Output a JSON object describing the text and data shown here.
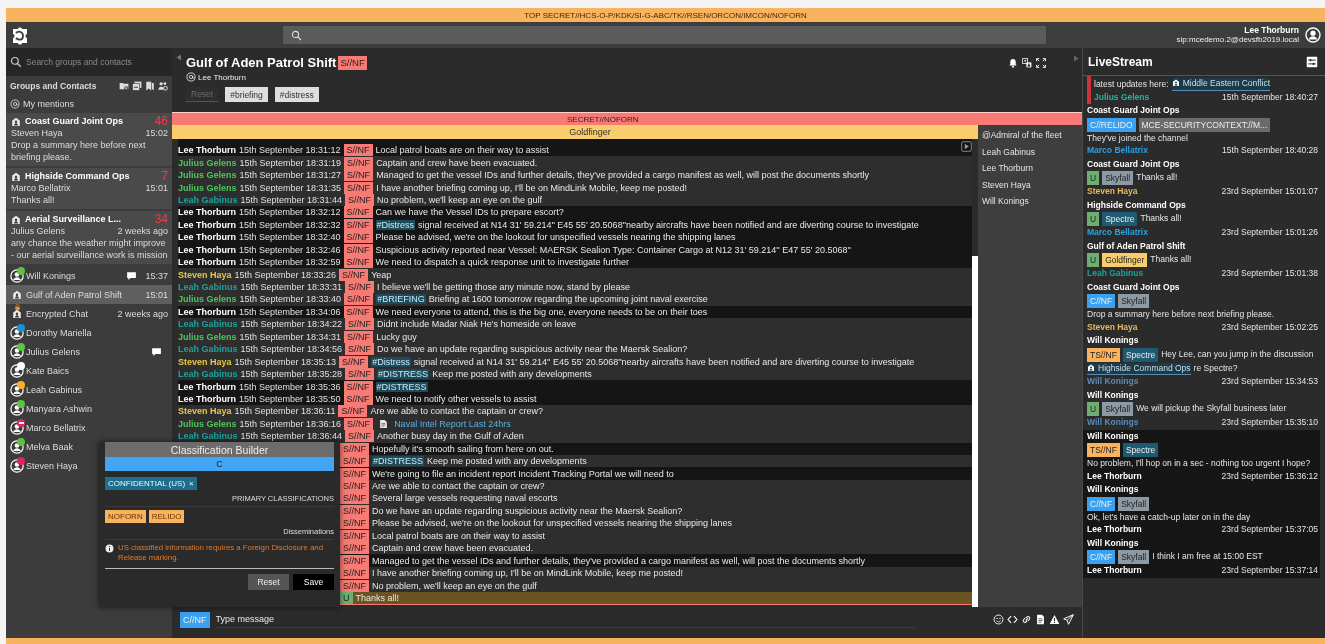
{
  "banner": {
    "text": "TOP SECRET//HCS-O-P/KDK/SI-G-ABC/TK//RSEN/ORCON/IMCON/NOFORN"
  },
  "header": {
    "user_name": "Lee Thorburn",
    "user_address": "sip:mcedemo.2@devsfb2019.local"
  },
  "sidebar": {
    "search": {
      "placeholder": "Search groups and contacts"
    },
    "section_title": "Groups and Contacts",
    "mentions": "My mentions",
    "items": [
      {
        "kind": "group-card",
        "title": "Coast Guard Joint Ops",
        "badge": "46",
        "sender": "Steven Haya",
        "time": "15:02",
        "preview": "Drop a summary here before next briefing please.",
        "selected": false
      },
      {
        "kind": "group-card",
        "title": "Highside Command Ops",
        "badge": "7",
        "sender": "Marco Bellatrix",
        "time": "15:01",
        "preview": "Thanks all!",
        "selected": false
      },
      {
        "kind": "group-card",
        "title": "Aerial Surveillance L...",
        "badge": "34",
        "sender": "Julius Gelens",
        "time": "2 weeks ago",
        "preview": "any chance the weather might improve - our aerial surveillance work is mission",
        "selected": false
      },
      {
        "kind": "contact",
        "title": "Will Konings",
        "time": "15:37",
        "color": "#5cc244",
        "chat": true,
        "busy": false,
        "selected": false
      },
      {
        "kind": "group",
        "title": "Gulf of Aden Patrol Shift",
        "time": "15:01",
        "locked": false,
        "selected": true
      },
      {
        "kind": "group",
        "title": "Encrypted Chat",
        "time": "2 weeks ago",
        "locked": true,
        "selected": false
      },
      {
        "kind": "contact",
        "title": "Dorothy Mariella",
        "color": "#1e8fd6",
        "chat": false,
        "busy": false,
        "selected": false
      },
      {
        "kind": "contact",
        "title": "Julius Gelens",
        "color": "#5cc244",
        "chat": true,
        "busy": false,
        "selected": false
      },
      {
        "kind": "contact",
        "title": "Kate Baics",
        "color": "#ffffff",
        "chat": false,
        "busy": false,
        "selected": false
      },
      {
        "kind": "contact",
        "title": "Leah Gabinus",
        "color": "#f5b428",
        "chat": false,
        "busy": false,
        "selected": false
      },
      {
        "kind": "contact",
        "title": "Manyara Ashwin",
        "color": "#5cc244",
        "chat": false,
        "busy": false,
        "selected": false
      },
      {
        "kind": "contact",
        "title": "Marco Bellatrix",
        "color": "#e0245e",
        "chat": false,
        "busy": true,
        "selected": false
      },
      {
        "kind": "contact",
        "title": "Melva Baak",
        "color": "#5cc244",
        "chat": false,
        "busy": false,
        "selected": false
      },
      {
        "kind": "contact",
        "title": "Steven Haya",
        "color": "#e0245e",
        "chat": false,
        "busy": false,
        "selected": false
      }
    ]
  },
  "chat": {
    "title": "Gulf of Aden Patrol Shift",
    "classification": "S//NF",
    "mention": "Lee Thorburn",
    "reset": {
      "label": "Reset",
      "disabled": true
    },
    "filters": [
      "#briefing",
      "#distress"
    ],
    "banner": "SECRET//NOFORN",
    "context": "Goldfinger",
    "messages": [
      {
        "sender": "Lee Thorburn",
        "time": "15th September 18:31:12",
        "color": "#ffffff",
        "own": true,
        "tag": {
          "label": "S//NF",
          "color": "#f77b74"
        },
        "text": "Local patrol boats are on their way to assist"
      },
      {
        "sender": "Julius Gelens",
        "time": "15th September 18:31:19",
        "color": "#4cc75a",
        "own": false,
        "tag": {
          "label": "S//NF",
          "color": "#f77b74"
        },
        "text": "Captain and crew have been evacuated."
      },
      {
        "sender": "Julius Gelens",
        "time": "15th September 18:31:27",
        "color": "#4cc75a",
        "own": false,
        "tag": {
          "label": "S//NF",
          "color": "#f77b74"
        },
        "text": "Managed to get the vessel IDs and further details, they've provided a cargo manifest as well, will post the documents shortly"
      },
      {
        "sender": "Julius Gelens",
        "time": "15th September 18:31:35",
        "color": "#4cc75a",
        "own": false,
        "tag": {
          "label": "S//NF",
          "color": "#f77b74"
        },
        "text": "I have another briefing coming up, I'll be on MindLink Mobile, keep me posted!"
      },
      {
        "sender": "Leah Gabinus",
        "time": "15th September 18:31:44",
        "color": "#1ba39c",
        "own": false,
        "tag": {
          "label": "S//NF",
          "color": "#f77b74"
        },
        "text": "No problem, we'll keep an eye on the gulf"
      },
      {
        "sender": "Lee Thorburn",
        "time": "15th September 18:32:12",
        "color": "#ffffff",
        "own": true,
        "tag": {
          "label": "S//NF",
          "color": "#f77b74"
        },
        "text": "Can we have the Vessel IDs to prepare escort?"
      },
      {
        "sender": "Lee Thorburn",
        "time": "15th September 18:32:32",
        "color": "#ffffff",
        "own": true,
        "tag": {
          "label": "S//NF",
          "color": "#f77b74"
        },
        "hashtag": "#Distress",
        "text": "signal received at N14 31' 59.214''  E45 55' 20.5068''nearby aircrafts have been notified and are diverting course to investigate"
      },
      {
        "sender": "Lee Thorburn",
        "time": "15th September 18:32:40",
        "color": "#ffffff",
        "own": true,
        "tag": {
          "label": "S//NF",
          "color": "#f77b74"
        },
        "text": "Please be advised, we're on the lookout for unspecified vessels nearing the shipping lanes"
      },
      {
        "sender": "Lee Thorburn",
        "time": "15th September 18:32:46",
        "color": "#ffffff",
        "own": true,
        "tag": {
          "label": "S//NF",
          "color": "#f77b74"
        },
        "text": "Suspicious activity reported near Vessel: MAERSK Sealion Type: Container Cargo at N12 31' 59.214''  E47 55' 20.5068''"
      },
      {
        "sender": "Lee Thorburn",
        "time": "15th September 18:32:59",
        "color": "#ffffff",
        "own": true,
        "tag": {
          "label": "S//NF",
          "color": "#f77b74"
        },
        "text": "We need to dispatch a quick response unit to investigate further"
      },
      {
        "sender": "Steven Haya",
        "time": "15th September 18:33:26",
        "color": "#e8c84a",
        "own": false,
        "tag": {
          "label": "S//NF",
          "color": "#f77b74"
        },
        "text": "Yeap"
      },
      {
        "sender": "Leah Gabinus",
        "time": "15th September 18:33:31",
        "color": "#1ba39c",
        "own": false,
        "tag": {
          "label": "S//NF",
          "color": "#f77b74"
        },
        "text": "I believe we'll be getting those any minute now, stand by please"
      },
      {
        "sender": "Julius Gelens",
        "time": "15th September 18:33:40",
        "color": "#4cc75a",
        "own": false,
        "tag": {
          "label": "S//NF",
          "color": "#f77b74"
        },
        "hashtag": "#BRIEFING",
        "text": "Briefing at 1600 tomorrow regarding the upcoming joint naval exercise"
      },
      {
        "sender": "Lee Thorburn",
        "time": "15th September 18:34:06",
        "color": "#ffffff",
        "own": true,
        "tag": {
          "label": "S//NF",
          "color": "#f77b74"
        },
        "text": "We need everyone to attend, this is the big one, everyone needs to be on their toes"
      },
      {
        "sender": "Leah Gabinus",
        "time": "15th September 18:34:22",
        "color": "#1ba39c",
        "own": false,
        "tag": {
          "label": "S//NF",
          "color": "#f77b74"
        },
        "text": "Didnt include Madar Niak He's homeside on leave"
      },
      {
        "sender": "Julius Gelens",
        "time": "15th September 18:34:31",
        "color": "#4cc75a",
        "own": false,
        "tag": {
          "label": "S//NF",
          "color": "#f77b74"
        },
        "text": "Lucky guy"
      },
      {
        "sender": "Leah Gabinus",
        "time": "15th September 18:34:56",
        "color": "#1ba39c",
        "own": false,
        "tag": {
          "label": "S//NF",
          "color": "#f77b74"
        },
        "text": "Do we have an update regarding suspicious activity near the Maersk Sealion?"
      },
      {
        "sender": "Steven Haya",
        "time": "15th September 18:35:13",
        "color": "#e8c84a",
        "own": false,
        "tag": {
          "label": "S//NF",
          "color": "#f77b74"
        },
        "hashtag": "#Distress",
        "text": "signal received at N14 31' 59.214''  E45 55' 20.5068''nearby aircrafts have been notified and are diverting course to investigate"
      },
      {
        "sender": "Leah Gabinus",
        "time": "15th September 18:35:28",
        "color": "#1ba39c",
        "own": false,
        "tag": {
          "label": "S//NF",
          "color": "#f77b74"
        },
        "hashtag": "#DISTRESS",
        "text": "Keep me posted with any developments"
      },
      {
        "sender": "Lee Thorburn",
        "time": "15th September 18:35:36",
        "color": "#ffffff",
        "own": true,
        "tag": {
          "label": "S//NF",
          "color": "#f77b74"
        },
        "hashtag": "#DISTRESS"
      },
      {
        "sender": "Lee Thorburn",
        "time": "15th September 18:35:50",
        "color": "#ffffff",
        "own": true,
        "tag": {
          "label": "S//NF",
          "color": "#f77b74"
        },
        "text": "We need to notify other vessels to assist"
      },
      {
        "sender": "Steven Haya",
        "time": "15th September 18:36:11",
        "color": "#e8c84a",
        "own": false,
        "tag": {
          "label": "S//NF",
          "color": "#f77b74"
        },
        "text": "Are we able to contact the captain or crew?"
      },
      {
        "sender": "Julius Gelens",
        "time": "15th September 18:36:16",
        "color": "#4cc75a",
        "own": false,
        "tag": {
          "label": "S//NF",
          "color": "#f77b74"
        },
        "attachment": "Naval Intel Report Last 24hrs"
      },
      {
        "sender": "Leah Gabinus",
        "time": "15th September 18:36:44",
        "color": "#1ba39c",
        "own": false,
        "tag": {
          "label": "S//NF",
          "color": "#f77b74"
        },
        "text": "Another busy day in the Gulf of Aden"
      },
      {
        "own": true,
        "tag": {
          "label": "S//NF",
          "color": "#f77b74"
        },
        "text": "Hopefully it's smooth sailing from here on out."
      },
      {
        "own": false,
        "tag": {
          "label": "S//NF",
          "color": "#f77b74"
        },
        "hashtag": "#DISTRESS",
        "text": "Keep me posted with any developments"
      },
      {
        "own": true,
        "tag": {
          "label": "S//NF",
          "color": "#f77b74"
        },
        "text": "We're going to file an incident report Incident Tracking Portal we will need to"
      },
      {
        "own": false,
        "tag": {
          "label": "S//NF",
          "color": "#f77b74"
        },
        "text": "Are we able to contact the captain or crew?"
      },
      {
        "own": false,
        "tag": {
          "label": "S//NF",
          "color": "#f77b74"
        },
        "text": "Several large vessels requesting naval escorts"
      },
      {
        "own": false,
        "tag": {
          "label": "S//NF",
          "color": "#f77b74"
        },
        "text": "Do we have an update regarding suspicious activity near the Maersk Sealion?"
      },
      {
        "own": false,
        "tag": {
          "label": "S//NF",
          "color": "#f77b74"
        },
        "text": "Please be advised, we're on the lookout for unspecified vessels nearing the shipping lanes"
      },
      {
        "own": false,
        "tag": {
          "label": "S//NF",
          "color": "#f77b74"
        },
        "text": "Local patrol boats are on their way to assist"
      },
      {
        "own": false,
        "tag": {
          "label": "S//NF",
          "color": "#f77b74"
        },
        "text": "Captain and crew have been evacuated."
      },
      {
        "own": true,
        "tag": {
          "label": "S//NF",
          "color": "#f77b74"
        },
        "text": "Managed to get the vessel IDs and further details, they've provided a cargo manifest as well, will post the documents shortly"
      },
      {
        "own": false,
        "tag": {
          "label": "S//NF",
          "color": "#f77b74"
        },
        "text": "I have another briefing coming up, I'll be on MindLink Mobile, keep me posted!"
      },
      {
        "own": false,
        "tag": {
          "label": "S//NF",
          "color": "#f77b74"
        },
        "text": "No problem, we'll keep an eye on the gulf"
      },
      {
        "own": false,
        "highlighted": true,
        "tag": {
          "label": "U",
          "color": "#6fae72"
        },
        "text": "Thanks all!"
      }
    ],
    "participants": [
      "@Admiral of the fleet",
      "Leah Gabinus",
      "Lee Thorburn",
      "Steven Haya",
      "Will Konings"
    ],
    "composer": {
      "classification": "C//NF",
      "placeholder": "Type message"
    }
  },
  "classification_builder": {
    "title": "Classification Builder",
    "level": "C",
    "primary": [
      {
        "label": "CONFIDENTIAL (US)",
        "remove": "×"
      }
    ],
    "primary_label": "PRIMARY CLASSIFICATIONS",
    "disseminations": [
      "NOFORN",
      "RELIDO"
    ],
    "disseminations_label": "Disseminations",
    "warning": "US classified information requires a Foreign Disclosure and Release marking.",
    "buttons": [
      {
        "label": "Reset",
        "kind": "secondary"
      },
      {
        "label": "Save",
        "kind": "primary"
      }
    ]
  },
  "livestream": {
    "title": "LiveStream",
    "items": [
      {
        "alert": true,
        "own": false,
        "text": "latest updates here:",
        "link": "Middle Eastern Conflict",
        "sender": {
          "name": "Julius Gelens",
          "color": "#2ab09a"
        },
        "time": "15th September 18:40:27"
      },
      {
        "alert": false,
        "own": false,
        "channel": "Coast Guard Joint Ops",
        "tags": [
          {
            "label": "C//RELIDO",
            "color": "#3aa0f0"
          },
          {
            "label": "MCE-SECURITYCONTEXT://M...",
            "color": "#6b6b6b"
          }
        ],
        "text": "They've joined the channel",
        "sender": {
          "name": "Marco Bellatrix",
          "color": "#2ea0e0"
        },
        "time": "15th September 18:40:28"
      },
      {
        "alert": false,
        "own": false,
        "channel": "Coast Guard Joint Ops",
        "tags": [
          {
            "label": "U",
            "color": "#6fae72"
          },
          {
            "label": "Skyfall",
            "color": "#8e9aa3"
          }
        ],
        "text": "Thanks all!",
        "sender": {
          "name": "Steven Haya",
          "color": "#e8b860"
        },
        "time": "23rd September 15:01:07"
      },
      {
        "alert": false,
        "own": false,
        "channel": "Highside Command Ops",
        "tags": [
          {
            "label": "U",
            "color": "#6fae72"
          },
          {
            "label": "Spectre",
            "color": "#1f5a73"
          }
        ],
        "text": "Thanks all!",
        "sender": {
          "name": "Marco Bellatrix",
          "color": "#2ea0e0"
        },
        "time": "23rd September 15:01:26"
      },
      {
        "alert": false,
        "own": false,
        "channel": "Gulf of Aden Patrol Shift",
        "tags": [
          {
            "label": "U",
            "color": "#6fae72"
          },
          {
            "label": "Goldfinger",
            "color": "#f9cd6b"
          }
        ],
        "text": "Thanks all!",
        "sender": {
          "name": "Leah Gabinus",
          "color": "#1ba39c"
        },
        "time": "23rd September 15:01:38"
      },
      {
        "alert": false,
        "own": false,
        "channel": "Coast Guard Joint Ops",
        "tags": [
          {
            "label": "C//NF",
            "color": "#3aa0f0"
          },
          {
            "label": "Skyfall",
            "color": "#8e9aa3"
          }
        ],
        "text": "Drop a summary here before next briefing please.",
        "sender": {
          "name": "Steven Haya",
          "color": "#e8b860"
        },
        "time": "23rd September 15:02:25"
      },
      {
        "alert": false,
        "own": false,
        "channel": "Will Konings",
        "tags": [
          {
            "label": "TS//NF",
            "color": "#f9b25e"
          },
          {
            "label": "Spectre",
            "color": "#1f5a73"
          }
        ],
        "text": "Hey Lee, can you jump in the discussion",
        "link": "Highside Command Ops",
        "text_after": "re Spectre?",
        "sender": {
          "name": "Will Konings",
          "color": "#5b8db8"
        },
        "time": "23rd September 15:34:53"
      },
      {
        "alert": false,
        "own": false,
        "channel": "Will Konings",
        "tags": [
          {
            "label": "U",
            "color": "#6fae72"
          },
          {
            "label": "Skyfall",
            "color": "#8e9aa3"
          }
        ],
        "text": "We will pickup the Skyfall business later",
        "sender": {
          "name": "Will Konings",
          "color": "#5b8db8"
        },
        "time": "23rd September 15:35:10"
      },
      {
        "alert": false,
        "own": true,
        "channel": "Will Konings",
        "tags": [
          {
            "label": "TS//NF",
            "color": "#f9b25e"
          },
          {
            "label": "Spectre",
            "color": "#1f5a73"
          }
        ],
        "text": "No problem, I'll hop on in a sec - nothing too urgent I hope?",
        "sender": {
          "name": "Lee Thorburn",
          "color": "#ffffff"
        },
        "time": "23rd September 15:36:12"
      },
      {
        "alert": false,
        "own": true,
        "channel": "Will Konings",
        "tags": [
          {
            "label": "C//NF",
            "color": "#3aa0f0"
          },
          {
            "label": "Skyfall",
            "color": "#8e9aa3"
          }
        ],
        "text": "Ok, let's have a catch-up later on in the day",
        "sender": {
          "name": "Lee Thorburn",
          "color": "#ffffff"
        },
        "time": "23rd September 15:37:05"
      },
      {
        "alert": false,
        "own": true,
        "channel": "Will Konings",
        "tags": [
          {
            "label": "C//NF",
            "color": "#3aa0f0"
          },
          {
            "label": "Skyfall",
            "color": "#8e9aa3"
          }
        ],
        "text": "I think I am free at 15:00 EST",
        "sender": {
          "name": "Lee Thorburn",
          "color": "#ffffff"
        },
        "time": "23rd September 15:37:14"
      }
    ]
  }
}
